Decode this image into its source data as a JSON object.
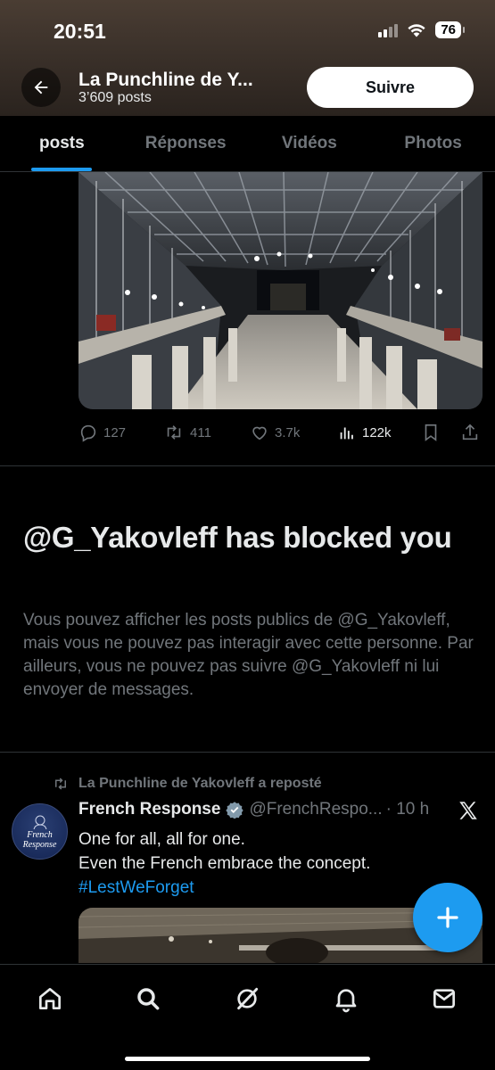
{
  "status_bar": {
    "time": "20:51",
    "battery": "76"
  },
  "header": {
    "profile_name": "La Punchline de Y...",
    "post_count": "3’609 posts",
    "follow_label": "Suivre"
  },
  "tabs": [
    {
      "label": "posts",
      "active": true
    },
    {
      "label": "Réponses",
      "active": false
    },
    {
      "label": "Vidéos",
      "active": false
    },
    {
      "label": "Photos",
      "active": false
    }
  ],
  "post_actions": {
    "replies": "127",
    "reposts": "411",
    "likes": "3.7k",
    "views": "122k"
  },
  "blocked_notice": {
    "title": "@G_Yakovleff has blocked you",
    "text": "Vous pouvez afficher les posts publics de @G_Yakovleff, mais vous ne pouvez pas interagir avec cette personne. Par ailleurs, vous ne pouvez pas suivre @G_Yakovleff ni lui envoyer de messages."
  },
  "repost": {
    "reposted_by": "La Punchline de Yakovleff a reposté",
    "author_name": "French Response",
    "author_handle": "@FrenchRespo...",
    "time": "· 10 h",
    "avatar_text_1": "French",
    "avatar_text_2": "Response",
    "text_line_1": "One for all, all for one.",
    "text_line_2": "Even the French embrace the concept.",
    "hashtag": "#LestWeForget"
  },
  "colors": {
    "accent": "#1d9bf0",
    "background": "#000000",
    "secondary_text": "#71767b",
    "primary_text": "#e7e9ea"
  },
  "icons": {
    "back": "arrow-left-icon",
    "reply": "speech-bubble-icon",
    "repost": "repost-arrows-icon",
    "like": "heart-icon",
    "views": "bar-chart-icon",
    "bookmark": "bookmark-icon",
    "share": "share-icon",
    "verified": "verified-badge-icon",
    "x_logo": "x-logo-icon",
    "compose": "plus-icon",
    "nav": [
      "home-icon",
      "search-icon",
      "grok-icon",
      "bell-icon",
      "mail-icon"
    ]
  }
}
